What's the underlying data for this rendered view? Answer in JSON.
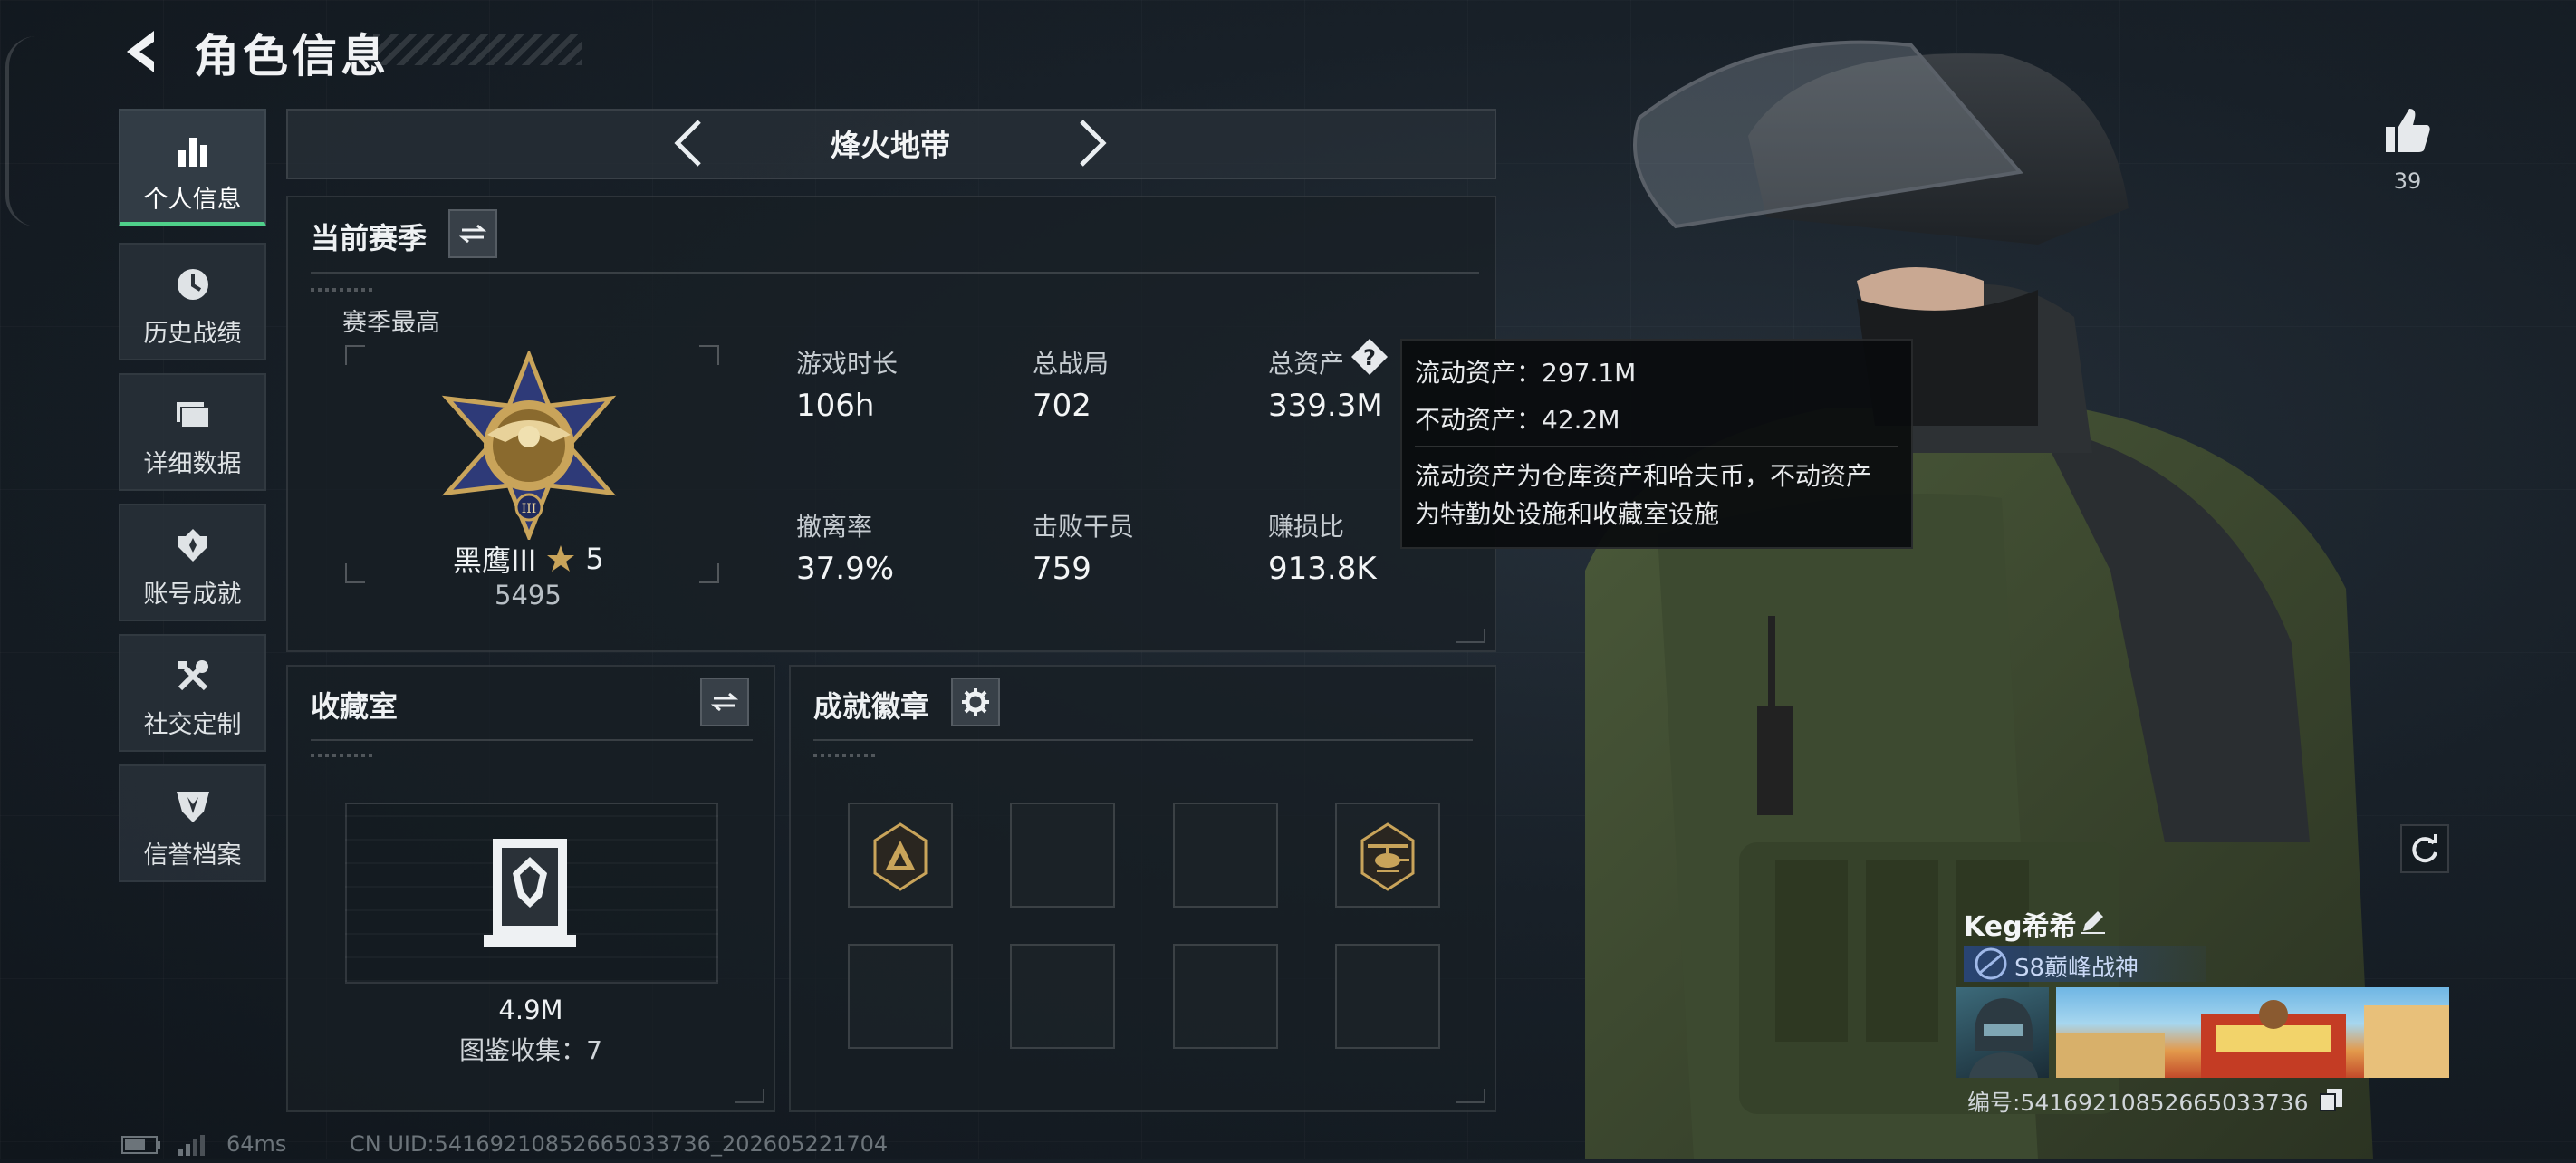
{
  "header": {
    "title": "角色信息"
  },
  "sidebar": {
    "items": [
      {
        "label": "个人信息",
        "icon": "bar-chart-icon",
        "active": true
      },
      {
        "label": "历史战绩",
        "icon": "clock-icon"
      },
      {
        "label": "详细数据",
        "icon": "folder-icon"
      },
      {
        "label": "账号成就",
        "icon": "medal-icon"
      },
      {
        "label": "社交定制",
        "icon": "wrench-icon"
      },
      {
        "label": "信誉档案",
        "icon": "shield-icon"
      }
    ]
  },
  "mode_switcher": {
    "label": "烽火地带"
  },
  "season": {
    "title": "当前赛季",
    "best_label": "赛季最高",
    "rank_name": "黑鹰III",
    "rank_stars": "5",
    "rank_points": "5495",
    "stats": [
      {
        "label": "游戏时长",
        "value": "106h"
      },
      {
        "label": "总战局",
        "value": "702"
      },
      {
        "label": "总资产",
        "value": "339.3M"
      },
      {
        "label": "撤离率",
        "value": "37.9%"
      },
      {
        "label": "击败干员",
        "value": "759"
      },
      {
        "label": "赚损比",
        "value": "913.8K"
      }
    ]
  },
  "tooltip": {
    "liquid": "流动资产：297.1M",
    "fixed": "不动资产：42.2M",
    "desc_line1": "流动资产为仓库资产和哈夫币，不动资产",
    "desc_line2": "为特勤处设施和收藏室设施"
  },
  "collection": {
    "title": "收藏室",
    "value": "4.9M",
    "catalog": "图鉴收集：7"
  },
  "badges": {
    "title": "成就徽章",
    "slots": 8
  },
  "likes": {
    "count": "39"
  },
  "profile": {
    "name": "Keg希希",
    "title": "S8巅峰战神",
    "id_label": "编号:54169210852665033736"
  },
  "footer": {
    "ping": "64ms",
    "uid": "CN UID:54169210852665033736_202605221704"
  },
  "colors": {
    "accent": "#4fd08a",
    "gold": "#c9a45a"
  }
}
